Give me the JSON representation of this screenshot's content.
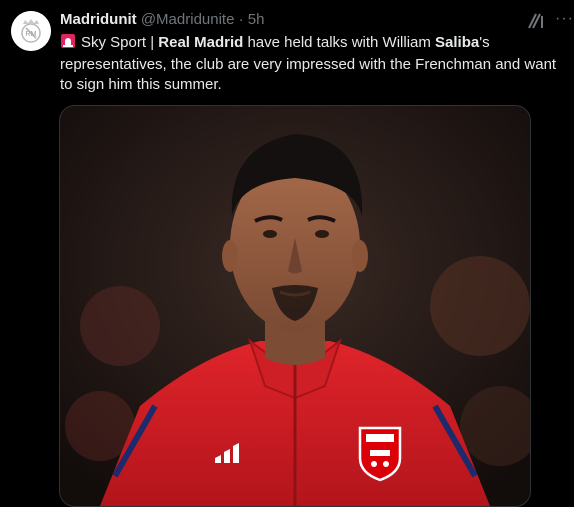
{
  "tweet": {
    "author_name": "Madridunit",
    "handle": "@Madridunite",
    "separator": "·",
    "time": "5h",
    "text_parts": {
      "p1": "Sky Sport | ",
      "p2": "Real Madrid",
      "p3": " have held talks with William ",
      "p4": "Saliba",
      "p5": "'s representatives, the club are very impressed with the Frenchman and want to sign him this summer."
    },
    "icons": {
      "avatar": "real-madrid-crest",
      "siren": "rotating-light-emoji",
      "grok": "grok-icon",
      "more": "more-icon"
    },
    "media": {
      "subject": "player-photo",
      "kit_colors": {
        "shirt": "#d71920",
        "trim": "#1d2a6b"
      }
    }
  }
}
